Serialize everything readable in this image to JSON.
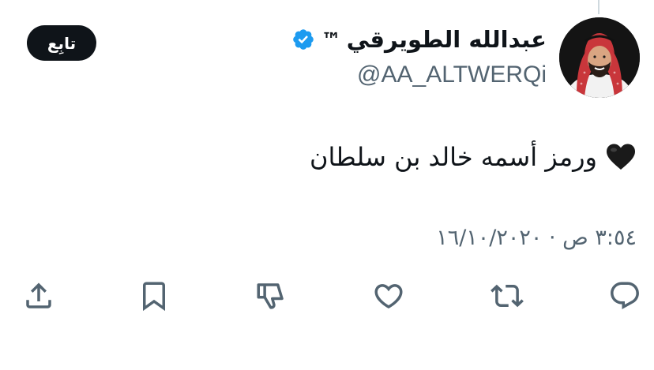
{
  "tweet": {
    "author": {
      "display_name": "عبدالله الطويرقي",
      "tm": "™",
      "handle": "@AA_ALTWERQi",
      "verified": true,
      "verified_color": "#1d9bf0"
    },
    "follow_button_label": "تابِع",
    "text": "ورمز أسمه خالد بن سلطان",
    "emoji": "black-heart",
    "timestamp": "٣:٥٤ ص · ١٦/١٠/٢٠٢٠"
  },
  "actions": [
    {
      "name": "reply",
      "icon": "reply-icon"
    },
    {
      "name": "retweet",
      "icon": "retweet-icon"
    },
    {
      "name": "like",
      "icon": "heart-icon"
    },
    {
      "name": "downvote",
      "icon": "thumbs-down-icon"
    },
    {
      "name": "bookmark",
      "icon": "bookmark-icon"
    },
    {
      "name": "share",
      "icon": "share-icon"
    }
  ],
  "colors": {
    "text": "#0f1419",
    "secondary": "#536471",
    "icon": "#536471",
    "button_bg": "#0f1419"
  }
}
